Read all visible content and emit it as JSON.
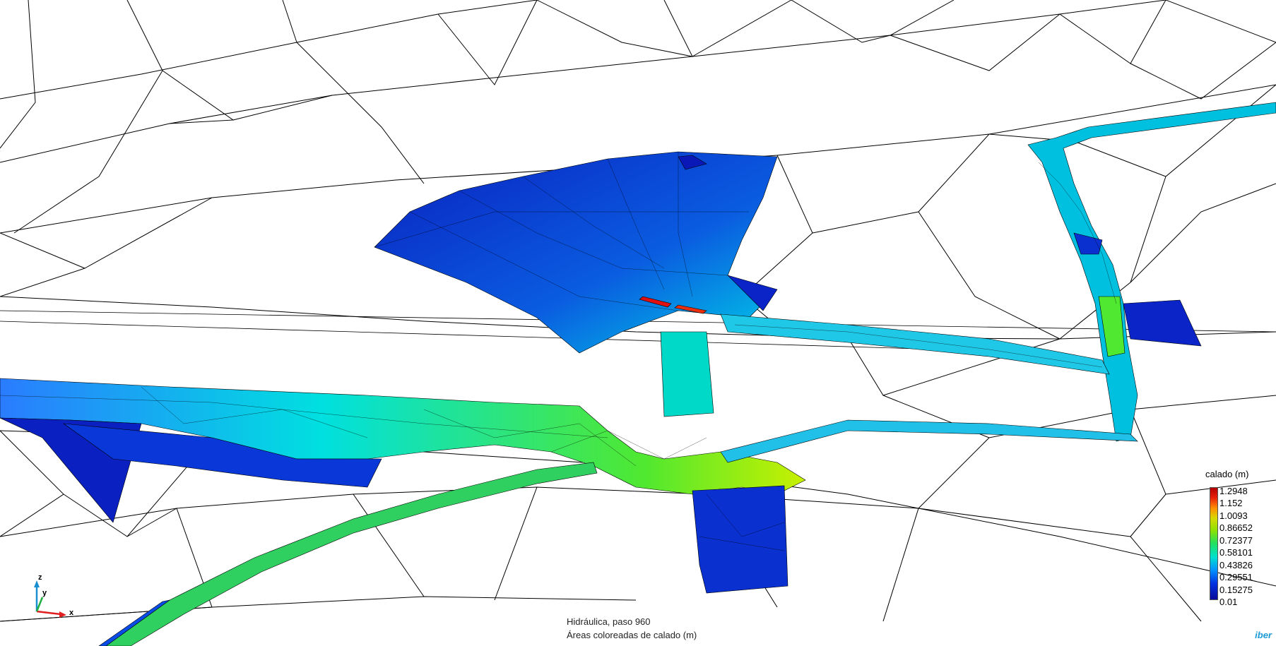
{
  "legend": {
    "title": "calado (m)",
    "labels": [
      "1.2948",
      "1.152",
      "1.0093",
      "0.86652",
      "0.72377",
      "0.58101",
      "0.43826",
      "0.29551",
      "0.15275",
      "0.01"
    ]
  },
  "caption": {
    "line1": "Hidráulica, paso 960",
    "line2": "Áreas coloreadas de calado (m)"
  },
  "axes": {
    "z": "z",
    "y": "y",
    "x": "x"
  },
  "brand": "iber",
  "colors": {
    "deep_blue": "#0a18c8",
    "blue": "#0a5cf0",
    "cyan": "#00d8e8",
    "green": "#40e040",
    "yellow_green": "#b8f000",
    "red": "#e01010"
  }
}
